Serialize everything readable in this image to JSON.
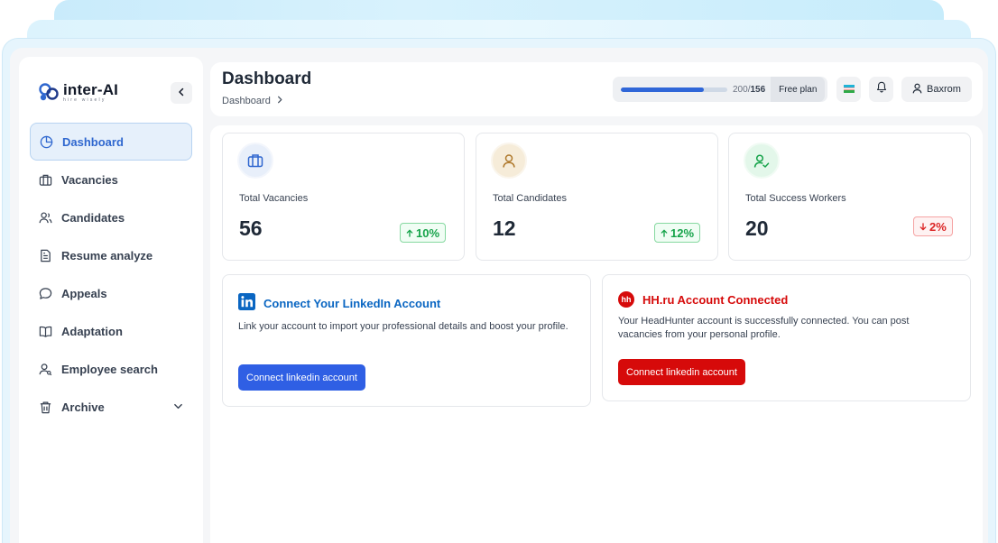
{
  "brand": {
    "name": "inter-AI",
    "tagline": "hire wisely",
    "logo_icon": "atom-logo-icon"
  },
  "sidebar": {
    "collapse_icon": "chevron-left-icon",
    "items": [
      {
        "label": "Dashboard",
        "icon": "pie-chart-icon",
        "active": true
      },
      {
        "label": "Vacancies",
        "icon": "briefcase-icon"
      },
      {
        "label": "Candidates",
        "icon": "users-icon"
      },
      {
        "label": "Resume analyze",
        "icon": "document-icon"
      },
      {
        "label": "Appeals",
        "icon": "message-icon"
      },
      {
        "label": "Adaptation",
        "icon": "book-icon"
      },
      {
        "label": "Employee search",
        "icon": "user-search-icon"
      },
      {
        "label": "Archive",
        "icon": "trash-icon",
        "expandable": true
      }
    ]
  },
  "header": {
    "title": "Dashboard",
    "breadcrumb": "Dashboard",
    "usage": {
      "used": "200",
      "separator": "/",
      "total": "156",
      "fill_fraction": 0.78
    },
    "plan": "Free plan",
    "language_icon": "uzbekistan-flag-icon",
    "notification_icon": "bell-icon",
    "user": {
      "name": "Baxrom",
      "icon": "user-icon"
    }
  },
  "stats": [
    {
      "label": "Total Vacancies",
      "value": "56",
      "trend": "10%",
      "direction": "up",
      "icon": "briefcase-icon"
    },
    {
      "label": "Total Candidates",
      "value": "12",
      "trend": "12%",
      "direction": "up",
      "icon": "user-icon"
    },
    {
      "label": "Total Success Workers",
      "value": "20",
      "trend": "2%",
      "direction": "down",
      "icon": "user-check-icon"
    }
  ],
  "linkedin": {
    "title": "Connect Your LinkedIn Account",
    "description": "Link your account to import your professional details and boost your profile.",
    "button": "Connect linkedin account",
    "icon": "linkedin-icon"
  },
  "hh": {
    "badge": "hh",
    "title": "HH.ru Account Connected",
    "description": "Your HeadHunter account is successfully connected. You can post vacancies from your personal profile.",
    "button": "Connect linkedin account"
  },
  "colors": {
    "primary": "#2f67cf",
    "linkedin": "#0a66c2",
    "hh_red": "#d60a0a",
    "trend_up": "#16a34a",
    "trend_down": "#dc2626"
  }
}
